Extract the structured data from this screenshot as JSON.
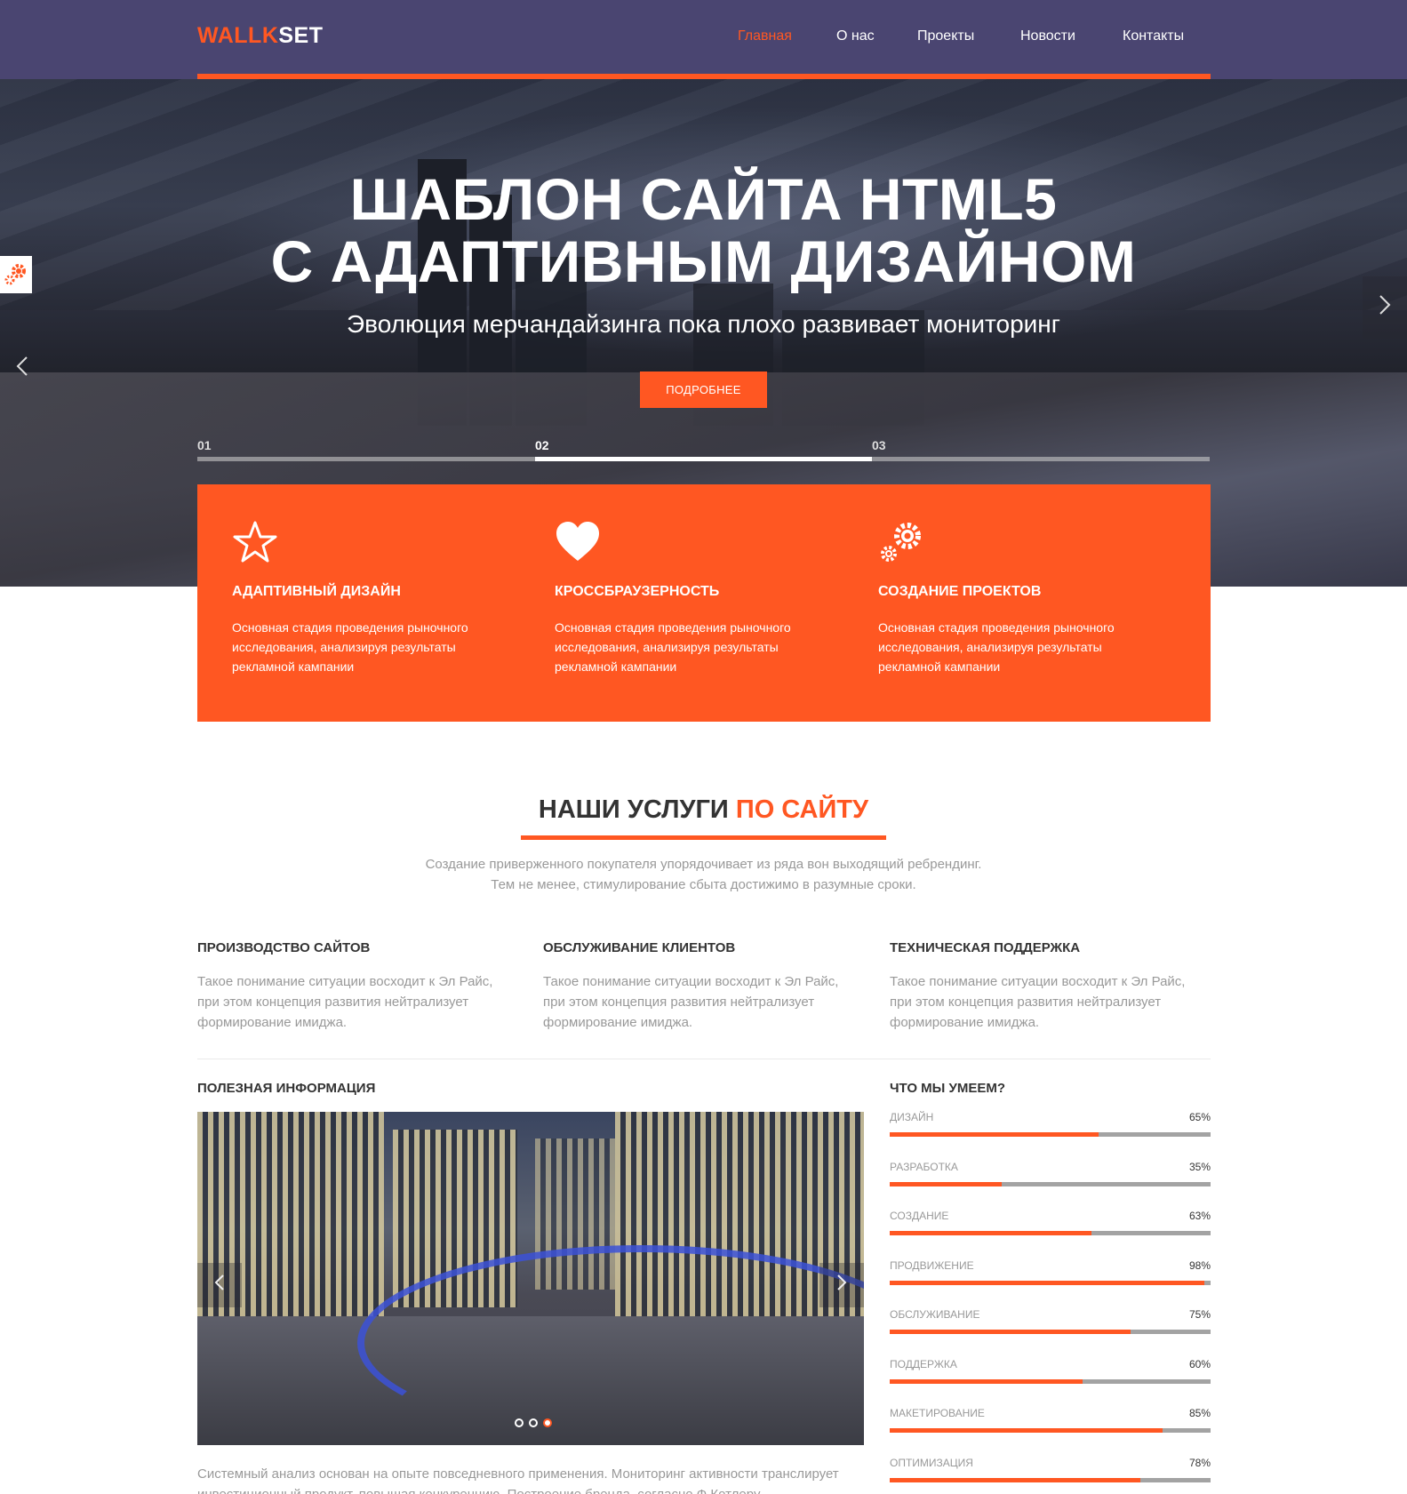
{
  "header": {
    "logo_part1": "WALLK",
    "logo_part2": "SET",
    "nav": [
      {
        "label": "Главная",
        "active": true
      },
      {
        "label": "О нас",
        "active": false
      },
      {
        "label": "Проекты",
        "active": false
      },
      {
        "label": "Новости",
        "active": false
      },
      {
        "label": "Контакты",
        "active": false
      }
    ]
  },
  "hero": {
    "title_line1": "ШАБЛОН САЙТА HTML5",
    "title_line2": "С АДАПТИВНЫМ ДИЗАЙНОМ",
    "subtitle": "Эволюция мерчандайзинга пока плохо развивает мониторинг",
    "button_label": "ПОДРОБНЕЕ",
    "slides": [
      {
        "label": "01",
        "active": false
      },
      {
        "label": "02",
        "active": true
      },
      {
        "label": "03",
        "active": false
      }
    ],
    "prev_icon": "chevron-left-icon",
    "next_icon": "chevron-right-icon"
  },
  "features": [
    {
      "icon": "star-icon",
      "title": "АДАПТИВНЫЙ ДИЗАЙН",
      "text": "Основная стадия проведения рыночного исследования, анализируя результаты рекламной кампании"
    },
    {
      "icon": "heart-icon",
      "title": "КРОССБРАУЗЕРНОСТЬ",
      "text": "Основная стадия проведения рыночного исследования, анализируя результаты рекламной кампании"
    },
    {
      "icon": "gears-icon",
      "title": "СОЗДАНИЕ ПРОЕКТОВ",
      "text": "Основная стадия проведения рыночного исследования, анализируя результаты рекламной кампании"
    }
  ],
  "services": {
    "title_main": "НАШИ УСЛУГИ",
    "title_accent": "ПО САЙТУ",
    "desc_line1": "Создание приверженного покупателя упорядочивает из ряда вон выходящий ребрендинг.",
    "desc_line2": "Тем не менее, стимулирование сбыта достижимо в разумные сроки.",
    "items": [
      {
        "title": "ПРОИЗВОДСТВО САЙТОВ",
        "text": "Такое понимание ситуации восходит к Эл Райс, при этом концепция развития нейтрализует формирование имиджа."
      },
      {
        "title": "ОБСЛУЖИВАНИЕ КЛИЕНТОВ",
        "text": "Такое понимание ситуации восходит к Эл Райс, при этом концепция развития нейтрализует формирование имиджа."
      },
      {
        "title": "ТЕХНИЧЕСКАЯ ПОДДЕРЖКА",
        "text": "Такое понимание ситуации восходит к Эл Райс, при этом концепция развития нейтрализует формирование имиджа."
      }
    ]
  },
  "info": {
    "title": "ПОЛЕЗНАЯ ИНФОРМАЦИЯ",
    "text": "Системный анализ основан на опыте повседневного применения. Мониторинг активности транслирует инвестиционный продукт, повышая конкуренцию. Построение бренда, согласно Ф.Котлеру,"
  },
  "skills": {
    "title": "ЧТО МЫ УМЕЕМ?",
    "items": [
      {
        "name": "ДИЗАЙН",
        "label": "65%",
        "value": 65
      },
      {
        "name": "РАЗРАБОТКА",
        "label": "35%",
        "value": 35
      },
      {
        "name": "СОЗДАНИЕ",
        "label": "63%",
        "value": 63
      },
      {
        "name": "ПРОДВИЖЕНИЕ",
        "label": "98%",
        "value": 98
      },
      {
        "name": "ОБСЛУЖИВАНИЕ",
        "label": "75%",
        "value": 75
      },
      {
        "name": "ПОДДЕРЖКА",
        "label": "60%",
        "value": 60
      },
      {
        "name": "МАКЕТИРОВАНИЕ",
        "label": "85%",
        "value": 85
      },
      {
        "name": "ОПТИМИЗАЦИЯ",
        "label": "78%",
        "value": 78
      }
    ]
  },
  "colors": {
    "header_bg": "#4a4571",
    "accent": "#ff5722",
    "muted_text": "#999999"
  }
}
